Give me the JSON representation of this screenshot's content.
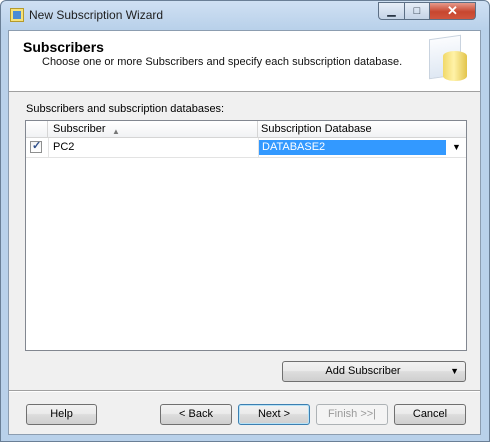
{
  "window": {
    "title": "New Subscription Wizard"
  },
  "header": {
    "title": "Subscribers",
    "subtitle": "Choose one or more Subscribers and specify each subscription database."
  },
  "section_label": "Subscribers and subscription databases:",
  "grid": {
    "columns": [
      "Subscriber",
      "Subscription Database"
    ],
    "rows": [
      {
        "checked": true,
        "subscriber": "PC2",
        "database": "DATABASE2"
      }
    ]
  },
  "buttons": {
    "add_subscriber": "Add Subscriber",
    "help": "Help",
    "back": "< Back",
    "next": "Next >",
    "finish": "Finish >>|",
    "cancel": "Cancel"
  },
  "icons": {
    "app": "wizard-app-icon",
    "header": "subscription-database-graphic",
    "sort": "sort-ascending-icon",
    "dropdown": "chevron-down-icon",
    "check": "checkmark-icon"
  },
  "colors": {
    "selection": "#3399ff",
    "title_bar": "#b9d1ea"
  }
}
